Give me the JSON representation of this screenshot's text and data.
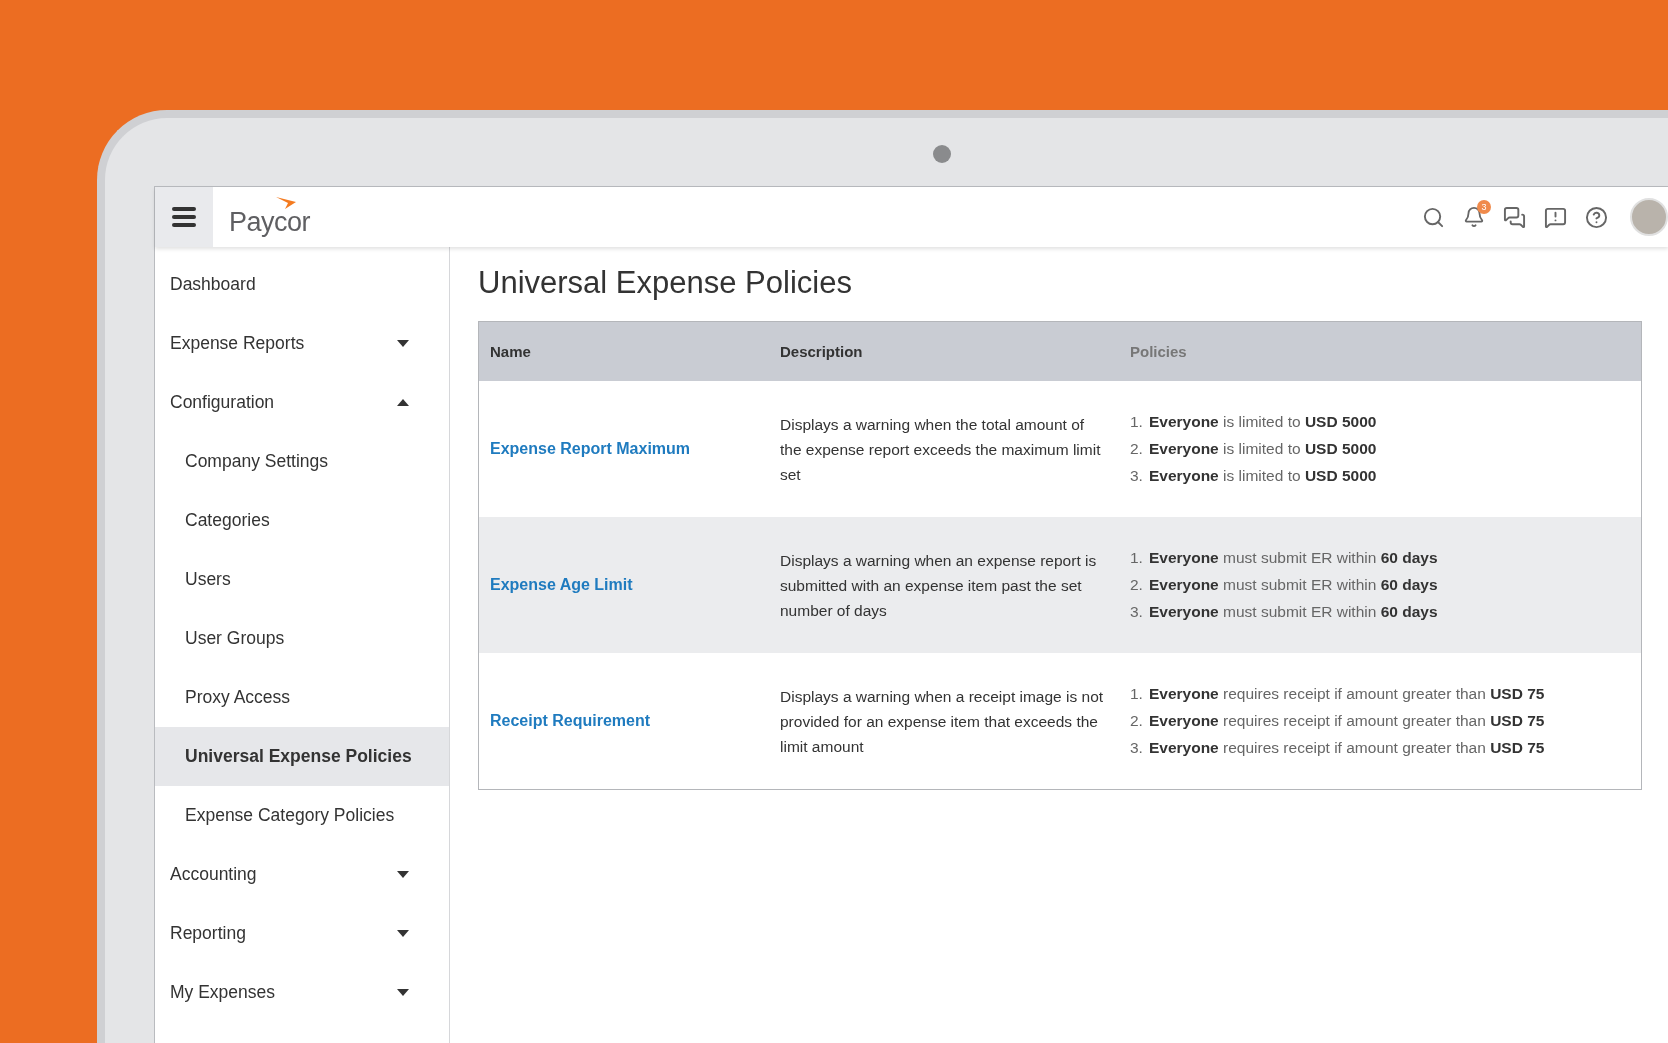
{
  "header": {
    "logo": "Paycor",
    "notifications": "3"
  },
  "sidebar": {
    "items": [
      {
        "label": "Dashboard",
        "kind": "link",
        "selected": false
      },
      {
        "label": "Expense Reports",
        "kind": "menu",
        "expanded": false,
        "selected": false
      },
      {
        "label": "Configuration",
        "kind": "menu",
        "expanded": true,
        "selected": false,
        "children": [
          {
            "label": "Company Settings",
            "selected": false
          },
          {
            "label": "Categories",
            "selected": false
          },
          {
            "label": "Users",
            "selected": false
          },
          {
            "label": "User Groups",
            "selected": false
          },
          {
            "label": "Proxy Access",
            "selected": false
          },
          {
            "label": "Universal Expense Policies",
            "selected": true
          },
          {
            "label": "Expense Category Policies",
            "selected": false
          }
        ]
      },
      {
        "label": "Accounting",
        "kind": "menu",
        "expanded": false,
        "selected": false
      },
      {
        "label": "Reporting",
        "kind": "menu",
        "expanded": false,
        "selected": false
      },
      {
        "label": "My Expenses",
        "kind": "menu",
        "expanded": false,
        "selected": false
      }
    ]
  },
  "page": {
    "title": "Universal Expense Policies"
  },
  "table": {
    "columns": [
      "Name",
      "Description",
      "Policies"
    ],
    "rows": [
      {
        "name": "Expense Report Maximum",
        "description": "Displays a warning when the total amount of the expense report exceeds the maximum limit set",
        "policies": [
          {
            "number": "1.",
            "text": "**Everyone** is limited to **USD 5000**"
          },
          {
            "number": "2.",
            "text": "**Everyone** is limited to **USD 5000**"
          },
          {
            "number": "3.",
            "text": "**Everyone** is limited to **USD 5000**"
          }
        ]
      },
      {
        "name": "Expense Age Limit",
        "description": "Displays a warning when an expense report is submitted with an expense item past the set number of days",
        "policies": [
          {
            "number": "1.",
            "text": "**Everyone** must submit ER within **60 days**"
          },
          {
            "number": "2.",
            "text": "**Everyone** must submit ER within **60 days**"
          },
          {
            "number": "3.",
            "text": "**Everyone** must submit ER within **60 days**"
          }
        ]
      },
      {
        "name": "Receipt Requirement",
        "description": "Displays a warning when a receipt image is not provided for an expense item that exceeds the limit amount",
        "policies": [
          {
            "number": "1.",
            "text": "**Everyone** requires receipt if amount greater than **USD 75**"
          },
          {
            "number": "2.",
            "text": "**Everyone** requires receipt if amount greater than **USD 75**"
          },
          {
            "number": "3.",
            "text": "**Everyone** requires receipt if amount greater than **USD 75**"
          }
        ]
      }
    ]
  }
}
